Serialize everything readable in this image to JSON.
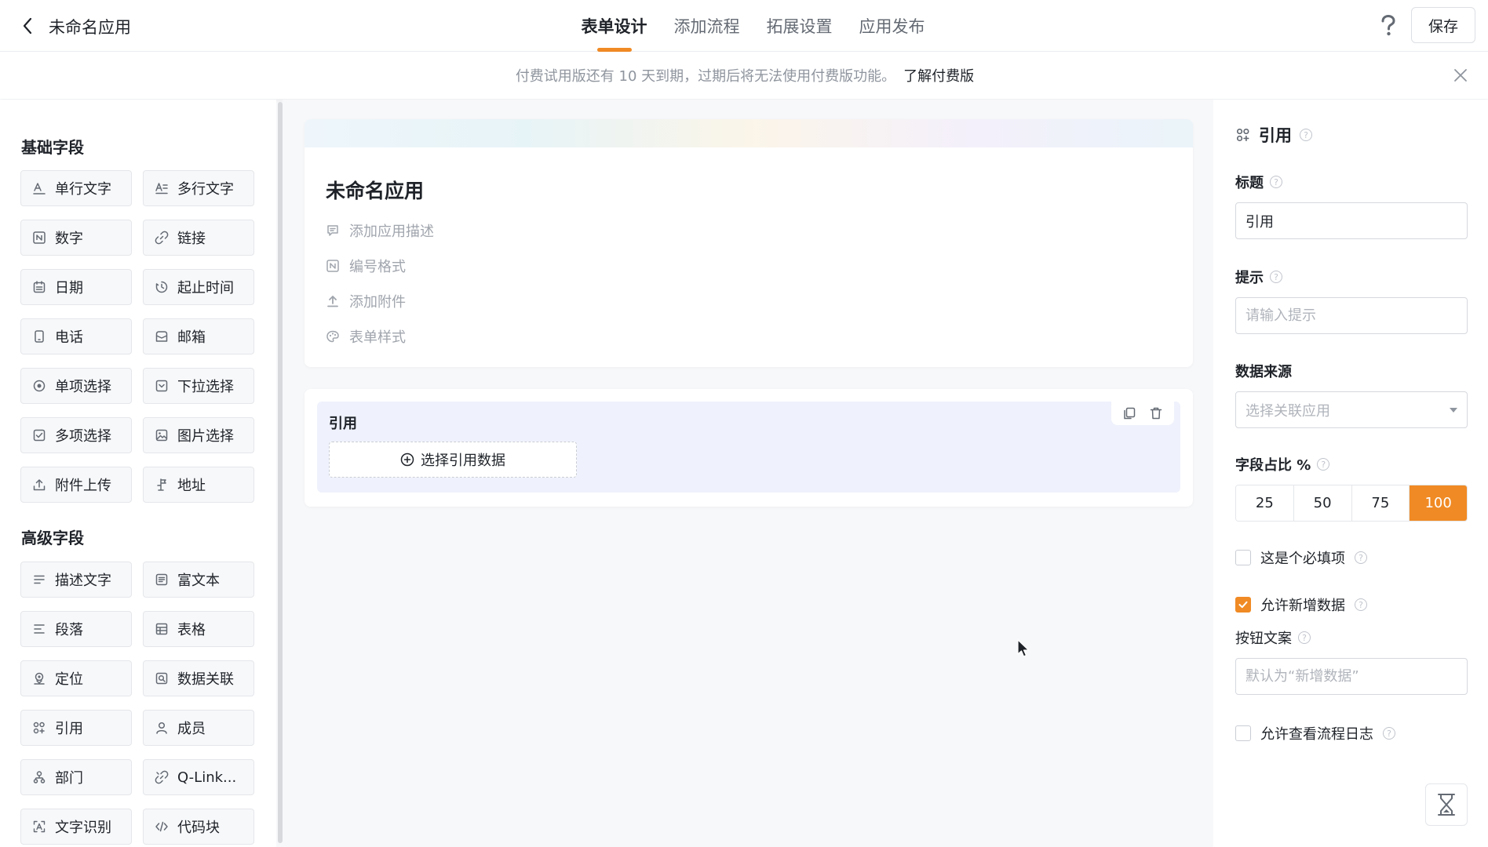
{
  "header": {
    "app_title": "未命名应用",
    "tabs": [
      {
        "label": "表单设计",
        "active": true
      },
      {
        "label": "添加流程",
        "active": false
      },
      {
        "label": "拓展设置",
        "active": false
      },
      {
        "label": "应用发布",
        "active": false
      }
    ],
    "save_label": "保存",
    "accent_color": "#f08a24"
  },
  "notice": {
    "text": "付费试用版还有 10 天到期，过期后将无法使用付费版功能。",
    "link": "了解付费版"
  },
  "left_panel": {
    "basic_title": "基础字段",
    "basic_fields": [
      {
        "label": "单行文字",
        "icon": "single-line-text-icon"
      },
      {
        "label": "多行文字",
        "icon": "multi-line-text-icon"
      },
      {
        "label": "数字",
        "icon": "number-icon"
      },
      {
        "label": "链接",
        "icon": "link-icon"
      },
      {
        "label": "日期",
        "icon": "calendar-icon"
      },
      {
        "label": "起止时间",
        "icon": "time-range-icon"
      },
      {
        "label": "电话",
        "icon": "phone-icon"
      },
      {
        "label": "邮箱",
        "icon": "mail-icon"
      },
      {
        "label": "单项选择",
        "icon": "radio-icon"
      },
      {
        "label": "下拉选择",
        "icon": "dropdown-icon"
      },
      {
        "label": "多项选择",
        "icon": "checkbox-icon"
      },
      {
        "label": "图片选择",
        "icon": "image-icon"
      },
      {
        "label": "附件上传",
        "icon": "upload-icon"
      },
      {
        "label": "地址",
        "icon": "address-icon"
      }
    ],
    "advanced_title": "高级字段",
    "advanced_fields": [
      {
        "label": "描述文字",
        "icon": "description-icon"
      },
      {
        "label": "富文本",
        "icon": "rich-text-icon"
      },
      {
        "label": "段落",
        "icon": "paragraph-icon"
      },
      {
        "label": "表格",
        "icon": "table-icon"
      },
      {
        "label": "定位",
        "icon": "location-icon"
      },
      {
        "label": "数据关联",
        "icon": "data-link-icon"
      },
      {
        "label": "引用",
        "icon": "reference-icon"
      },
      {
        "label": "成员",
        "icon": "member-icon"
      },
      {
        "label": "部门",
        "icon": "department-icon"
      },
      {
        "label": "Q-Link...",
        "icon": "qlink-icon"
      },
      {
        "label": "文字识别",
        "icon": "ocr-icon"
      },
      {
        "label": "代码块",
        "icon": "code-icon"
      }
    ]
  },
  "form": {
    "title": "未命名应用",
    "meta": [
      {
        "label": "添加应用描述",
        "icon": "comment-icon"
      },
      {
        "label": "编号格式",
        "icon": "number-format-icon"
      },
      {
        "label": "添加附件",
        "icon": "attachment-upload-icon"
      },
      {
        "label": "表单样式",
        "icon": "palette-icon"
      }
    ],
    "field": {
      "label": "引用",
      "select_label": "选择引用数据"
    }
  },
  "right_panel": {
    "title": "引用",
    "title_label": "标题",
    "title_value": "引用",
    "hint_label": "提示",
    "hint_placeholder": "请输入提示",
    "source_label": "数据来源",
    "source_placeholder": "选择关联应用",
    "ratio_label": "字段占比 %",
    "ratio_options": [
      "25",
      "50",
      "75",
      "100"
    ],
    "ratio_selected": "100",
    "required_label": "这是个必填项",
    "required_checked": false,
    "allow_add_label": "允许新增数据",
    "allow_add_checked": true,
    "button_text_label": "按钮文案",
    "button_text_placeholder": "默认为“新增数据”",
    "view_log_label": "允许查看流程日志",
    "view_log_checked": false
  }
}
